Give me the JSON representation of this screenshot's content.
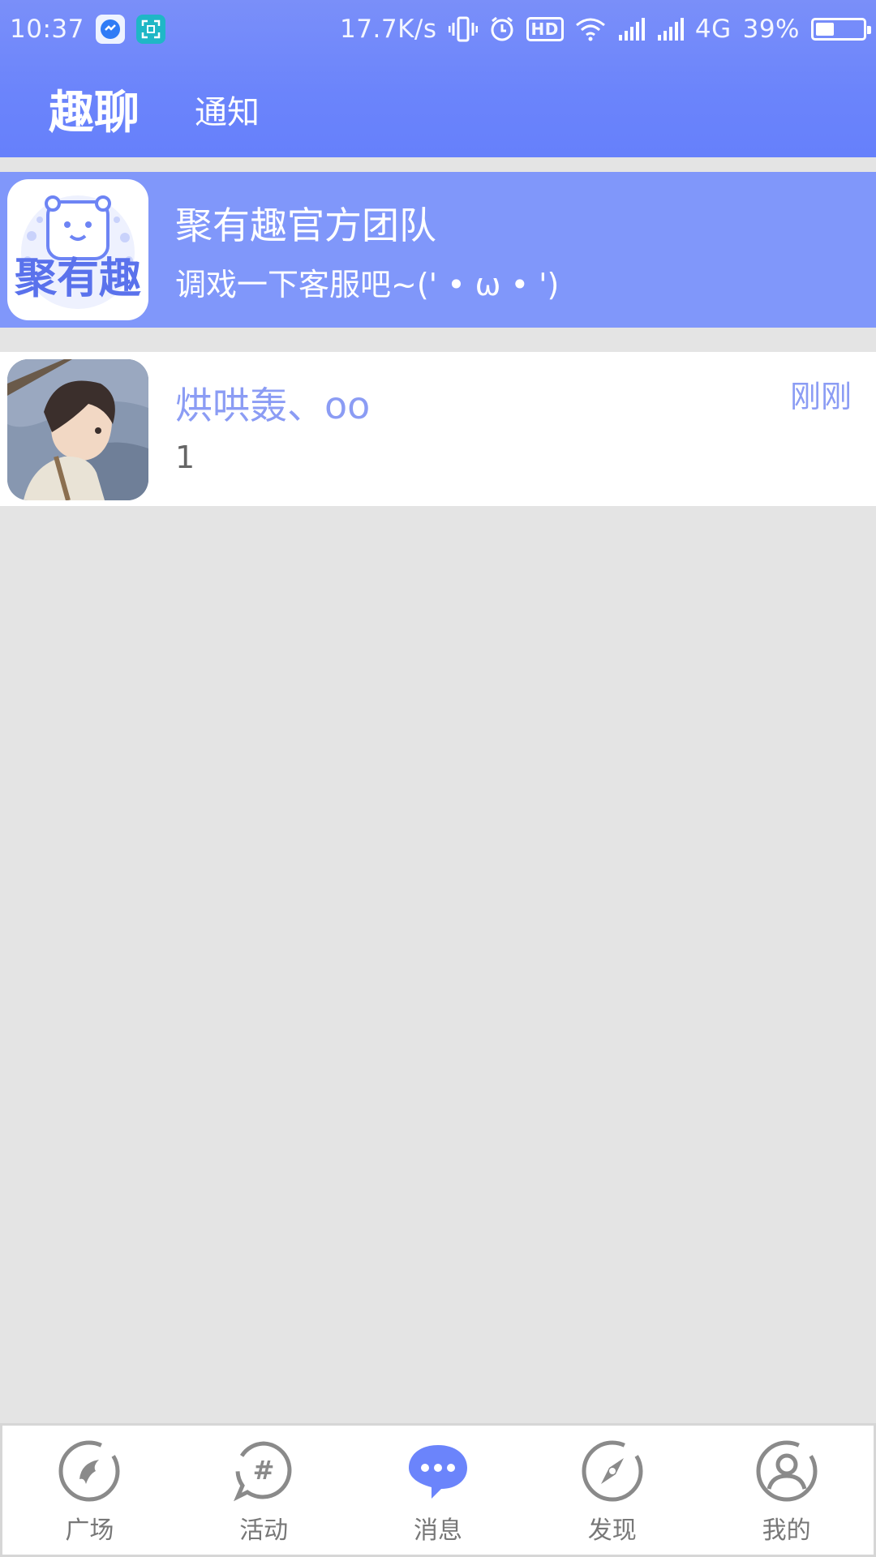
{
  "status_bar": {
    "time": "10:37",
    "net_speed": "17.7K/s",
    "hd_badge": "HD",
    "network_type": "4G",
    "battery_percent": "39%",
    "battery_level": 0.39,
    "icons": [
      "messenger-app-icon",
      "screenshot-icon",
      "vibrate-icon",
      "alarm-icon",
      "hd-icon",
      "wifi-icon",
      "signal-icon",
      "signal-icon",
      "battery-icon"
    ]
  },
  "app_bar": {
    "title": "趣聊",
    "tab": "通知"
  },
  "conversations": [
    {
      "name": "聚有趣官方团队",
      "preview": "调戏一下客服吧~(' • ω • ')",
      "avatar_text": "聚有趣",
      "avatar_icon": "bear-logo-icon",
      "highlight_color": "#8097fa"
    },
    {
      "name": "烘哄轰、oo",
      "preview": "1",
      "time": "刚刚",
      "avatar_icon": "anime-avatar-icon"
    }
  ],
  "bottom_nav": {
    "items": [
      {
        "label": "广场",
        "icon": "plaza-icon",
        "active": false
      },
      {
        "label": "活动",
        "icon": "hashtag-icon",
        "active": false
      },
      {
        "label": "消息",
        "icon": "chat-icon",
        "active": true
      },
      {
        "label": "发现",
        "icon": "compass-icon",
        "active": false
      },
      {
        "label": "我的",
        "icon": "profile-icon",
        "active": false
      }
    ],
    "active_color": "#6b84fb",
    "inactive_color": "#8a8a8a"
  }
}
